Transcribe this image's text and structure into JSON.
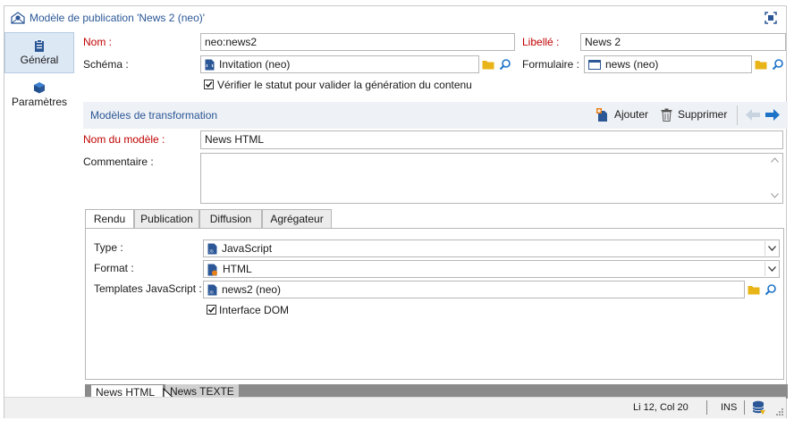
{
  "window": {
    "title": "Modèle de publication 'News 2 (neo)'"
  },
  "sidebar": {
    "items": [
      {
        "label": "Général",
        "icon": "clipboard-icon",
        "active": true
      },
      {
        "label": "Paramètres",
        "icon": "cube-icon",
        "active": false
      }
    ]
  },
  "form": {
    "nom_label": "Nom :",
    "nom_value": "neo:news2",
    "libelle_label": "Libellé :",
    "libelle_value": "News 2",
    "schema_label": "Schéma :",
    "schema_value": "Invitation (neo)",
    "formulaire_label": "Formulaire :",
    "formulaire_value": "news (neo)",
    "verify_label": "Vérifier le statut pour valider la génération du contenu",
    "verify_checked": true
  },
  "section": {
    "title": "Modèles de transformation",
    "add_label": "Ajouter",
    "delete_label": "Supprimer"
  },
  "model": {
    "name_label": "Nom du modèle :",
    "name_value": "News HTML",
    "comment_label": "Commentaire :",
    "comment_value": ""
  },
  "tabs": [
    {
      "label": "Rendu",
      "active": true
    },
    {
      "label": "Publication",
      "active": false
    },
    {
      "label": "Diffusion",
      "active": false
    },
    {
      "label": "Agrégateur",
      "active": false
    }
  ],
  "rendu": {
    "type_label": "Type :",
    "type_value": "JavaScript",
    "format_label": "Format :",
    "format_value": "HTML",
    "templates_label": "Templates JavaScript :",
    "templates_value": "news2 (neo)",
    "dom_label": "Interface DOM",
    "dom_checked": true
  },
  "bottom_tabs": [
    {
      "label": "News HTML",
      "active": true
    },
    {
      "label": "News TEXTE",
      "active": false
    }
  ],
  "status": {
    "position": "Li 12, Col 20",
    "mode": "INS"
  },
  "colors": {
    "accent": "#2b5797",
    "required_label": "#c00000",
    "folder": "#e8b418",
    "arrow": "#1e73c8"
  }
}
